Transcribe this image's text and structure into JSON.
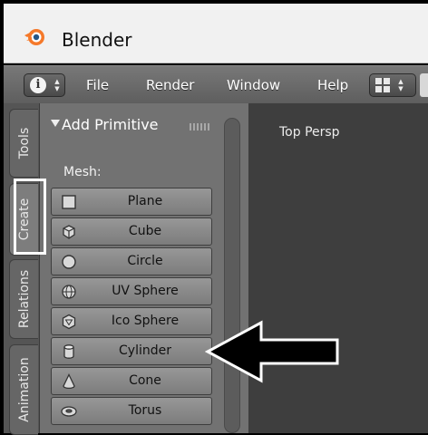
{
  "window": {
    "title": "Blender",
    "logo_icon": "blender-logo-icon"
  },
  "header": {
    "editor_type_icon": "info-icon",
    "menu": [
      "File",
      "Render",
      "Window",
      "Help"
    ],
    "layout_icon": "screen-layout-icon"
  },
  "tabs": {
    "tools": "Tools",
    "create": "Create",
    "relations": "Relations",
    "animation": "Animation"
  },
  "panel": {
    "title": "Add Primitive",
    "section_label": "Mesh:",
    "primitives": [
      {
        "label": "Plane",
        "icon": "plane-icon"
      },
      {
        "label": "Cube",
        "icon": "cube-icon"
      },
      {
        "label": "Circle",
        "icon": "circle-icon"
      },
      {
        "label": "UV Sphere",
        "icon": "uv-sphere-icon"
      },
      {
        "label": "Ico Sphere",
        "icon": "ico-sphere-icon"
      },
      {
        "label": "Cylinder",
        "icon": "cylinder-icon"
      },
      {
        "label": "Cone",
        "icon": "cone-icon"
      },
      {
        "label": "Torus",
        "icon": "torus-icon"
      }
    ]
  },
  "viewport": {
    "label": "Top Persp"
  },
  "annotations": {
    "highlighted_tab": "Create",
    "pointed_item": "Cylinder",
    "color": "#ffffff"
  }
}
